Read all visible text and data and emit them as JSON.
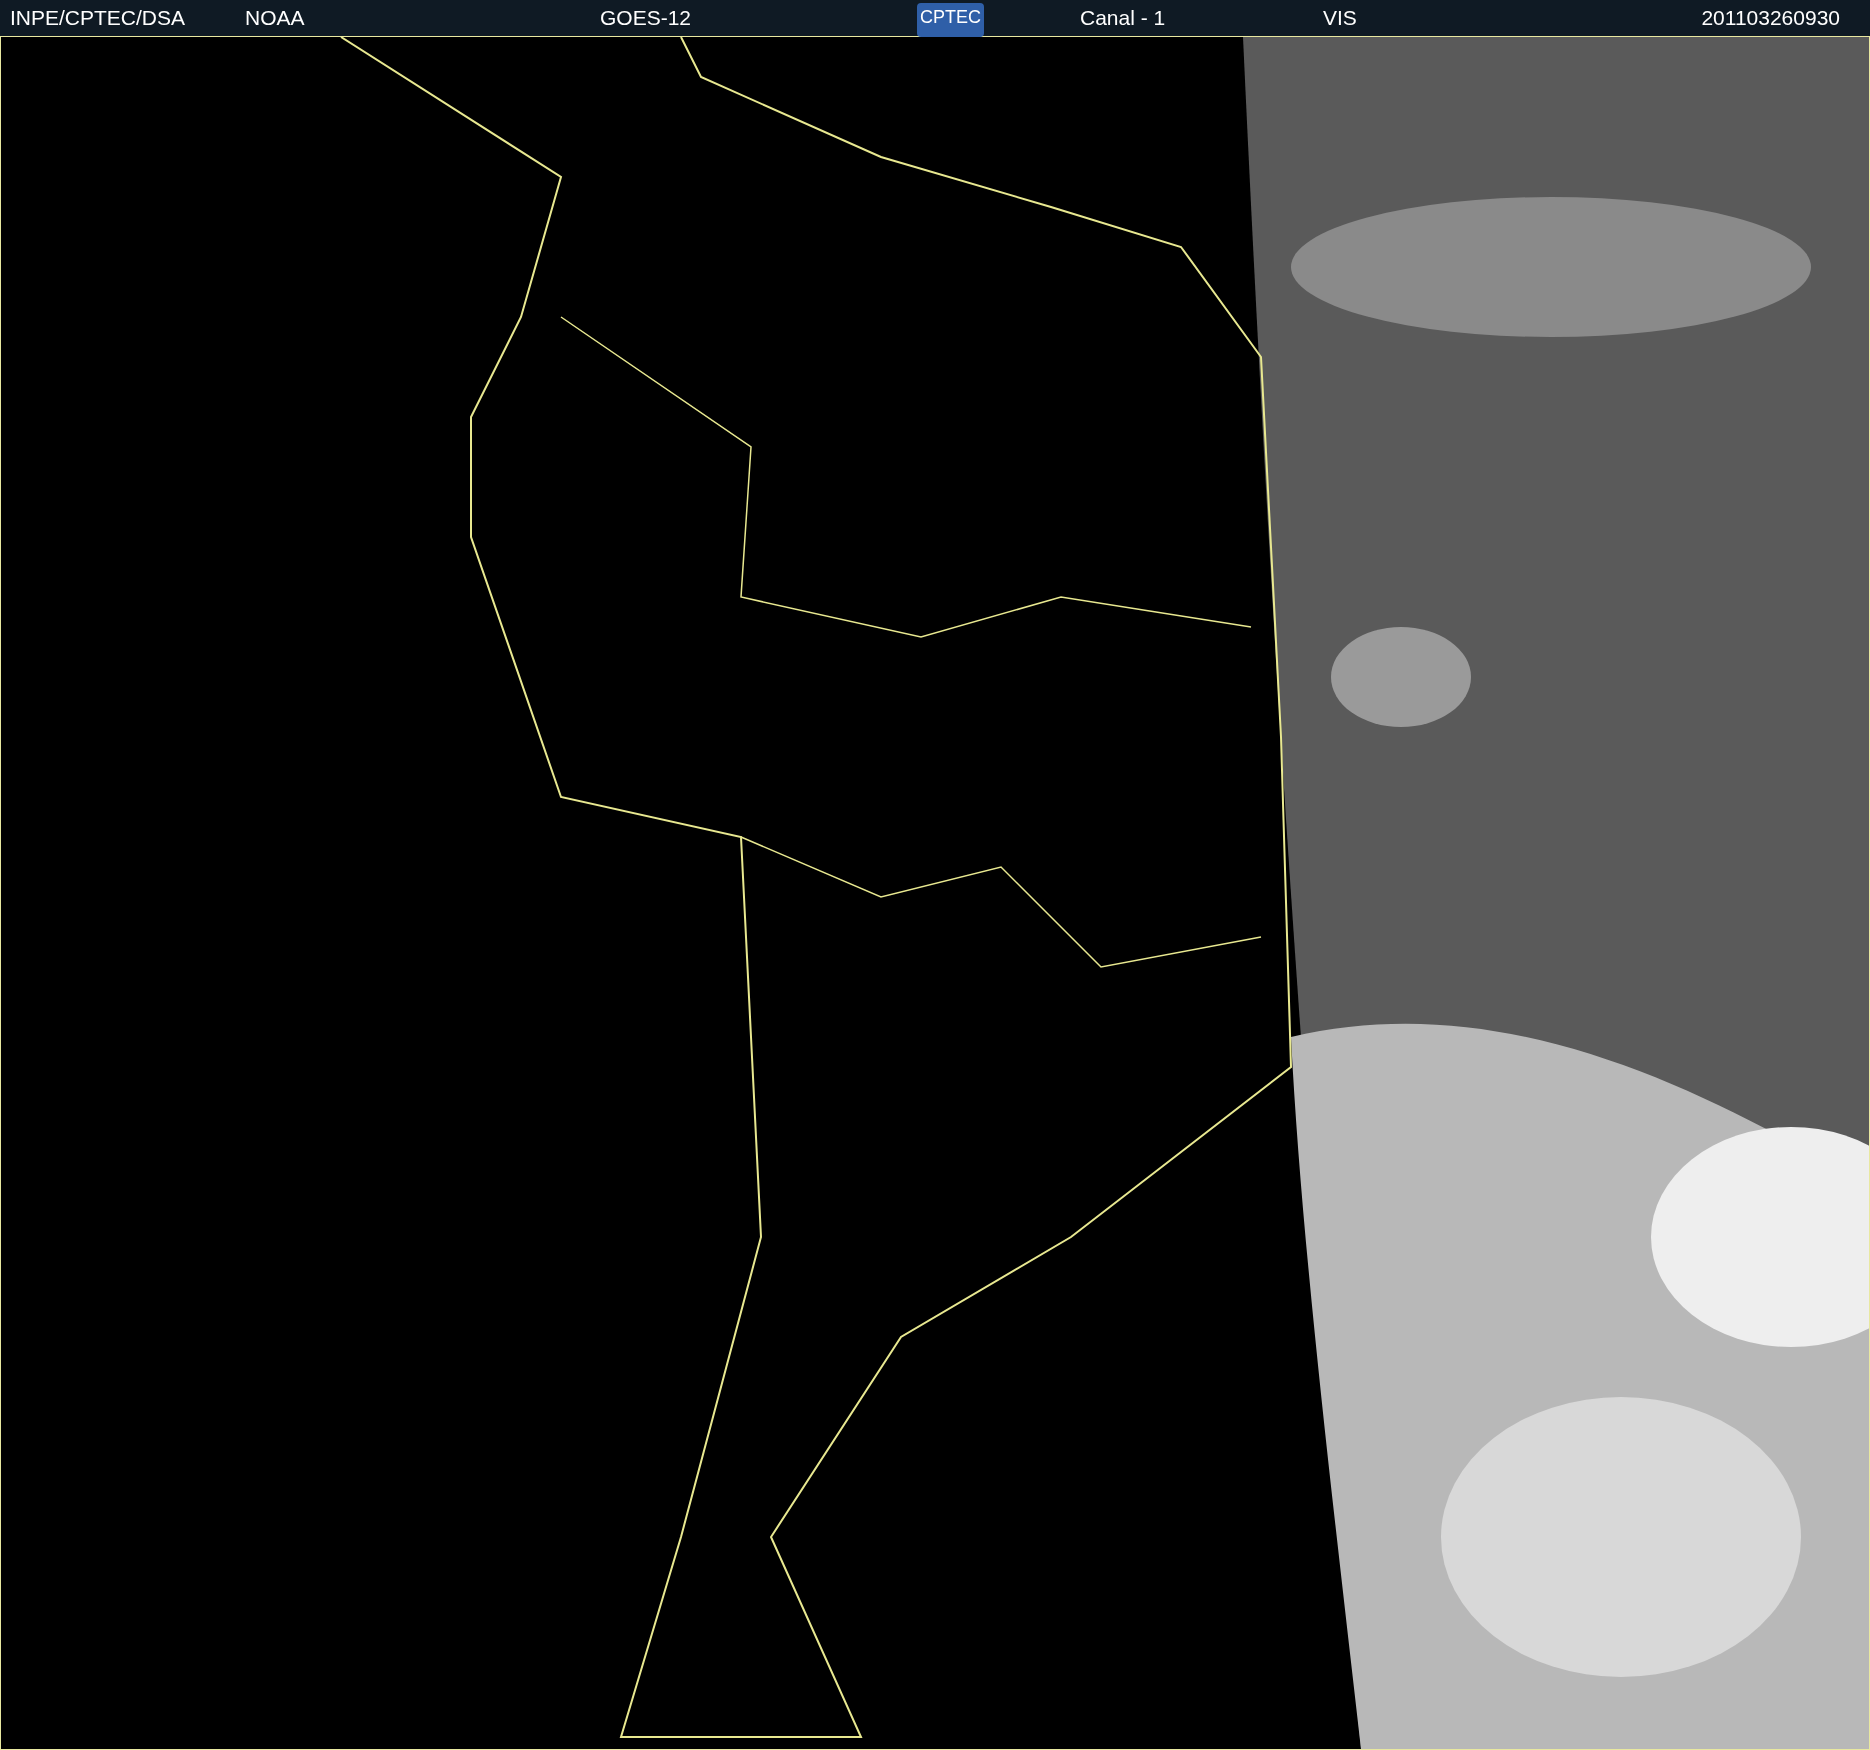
{
  "header": {
    "items": [
      {
        "kind": "text",
        "text": "INPE/CPTEC/DSA"
      },
      {
        "kind": "text",
        "text": "NOAA"
      },
      {
        "kind": "text",
        "text": "GOES-12"
      },
      {
        "kind": "logo",
        "text": "CPTEC"
      },
      {
        "kind": "text",
        "text": "Canal - 1"
      },
      {
        "kind": "text",
        "text": "VIS"
      },
      {
        "kind": "text",
        "text": "201103260930"
      }
    ]
  }
}
